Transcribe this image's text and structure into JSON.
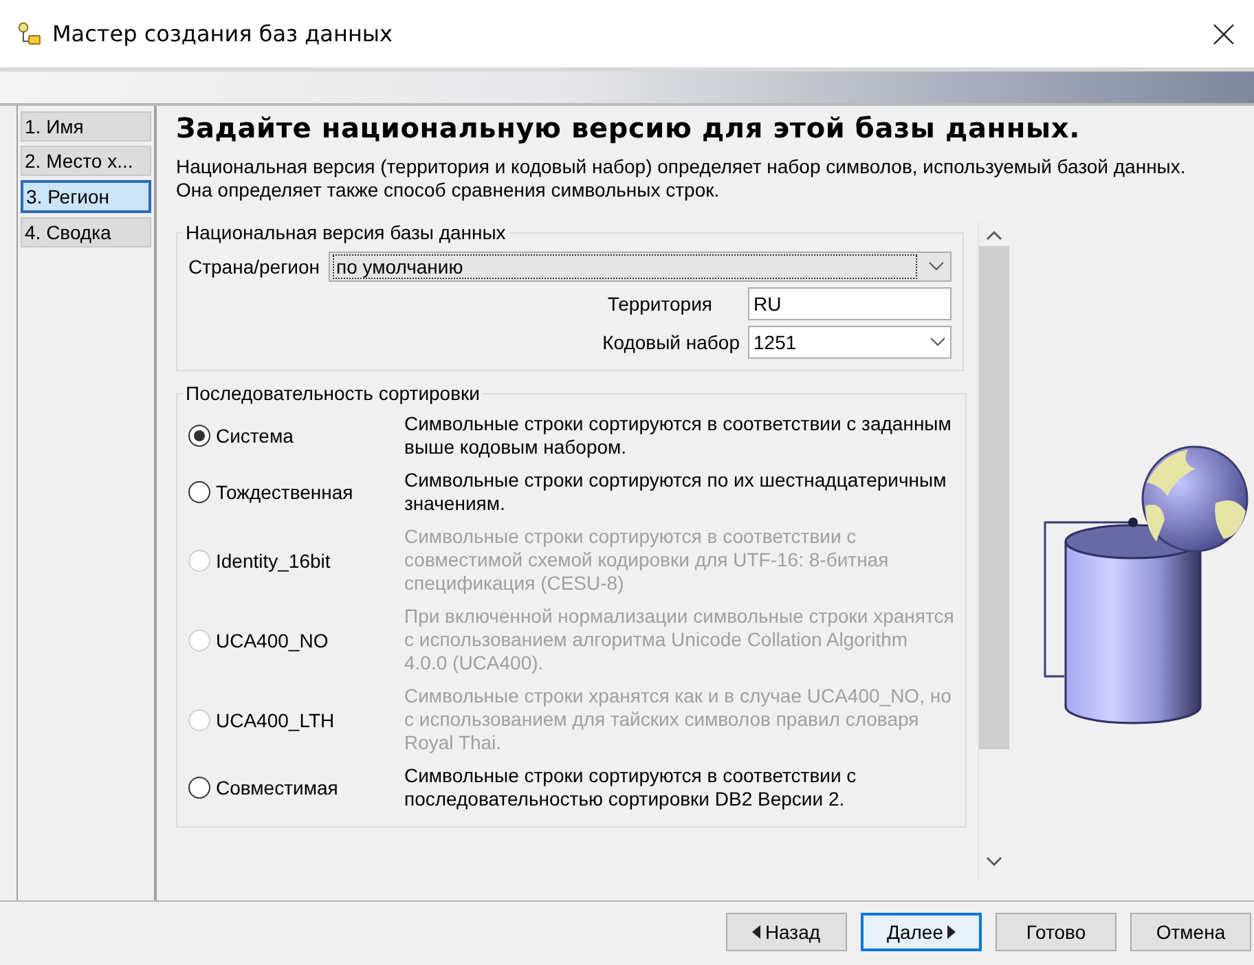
{
  "window": {
    "title": "Мастер создания баз данных"
  },
  "steps": [
    {
      "label": "1. Имя",
      "selected": false
    },
    {
      "label": "2. Место х...",
      "selected": false
    },
    {
      "label": "3. Регион",
      "selected": true
    },
    {
      "label": "4. Сводка",
      "selected": false
    }
  ],
  "heading": "Задайте национальную версию для этой базы данных.",
  "description": "Национальная версия (территория и кодовый набор) определяет набор символов, используемый базой данных. Она определяет также способ сравнения символьных строк.",
  "locale_group": {
    "legend": "Национальная версия базы данных",
    "country_label": "Страна/регион",
    "country_value": "по умолчанию",
    "territory_label": "Территория",
    "territory_value": "RU",
    "codeset_label": "Кодовый набор",
    "codeset_value": "1251"
  },
  "collation_group": {
    "legend": "Последовательность сортировки",
    "options": [
      {
        "label": "Система",
        "description": "Символьные строки сортируются в соответствии с заданным выше кодовым набором.",
        "selected": true,
        "disabled": false
      },
      {
        "label": "Тождественная",
        "description": "Символьные строки сортируются по их шестнадцатеричным значениям.",
        "selected": false,
        "disabled": false
      },
      {
        "label": "Identity_16bit",
        "description": "Символьные строки сортируются в соответствии с совместимой схемой кодировки для UTF-16: 8-битная спецификация (CESU-8)",
        "selected": false,
        "disabled": true
      },
      {
        "label": "UCA400_NO",
        "description": "При включенной нормализации символьные строки хранятся с использованием алгоритма Unicode Collation Algorithm 4.0.0 (UCA400).",
        "selected": false,
        "disabled": true
      },
      {
        "label": "UCA400_LTH",
        "description": "Символьные строки хранятся как и в случае UCA400_NO, но с использованием для тайских символов правил словаря Royal Thai.",
        "selected": false,
        "disabled": true
      },
      {
        "label": "Совместимая",
        "description": "Символьные строки сортируются в соответствии с последовательностью сортировки DB2 Версии 2.",
        "selected": false,
        "disabled": false
      }
    ]
  },
  "buttons": [
    {
      "label": "Назад",
      "kind": "back",
      "focused": false
    },
    {
      "label": "Далее",
      "kind": "next",
      "focused": true
    },
    {
      "label": "Готово",
      "kind": "plain",
      "focused": false
    },
    {
      "label": "Отмена",
      "kind": "plain",
      "focused": false
    }
  ]
}
